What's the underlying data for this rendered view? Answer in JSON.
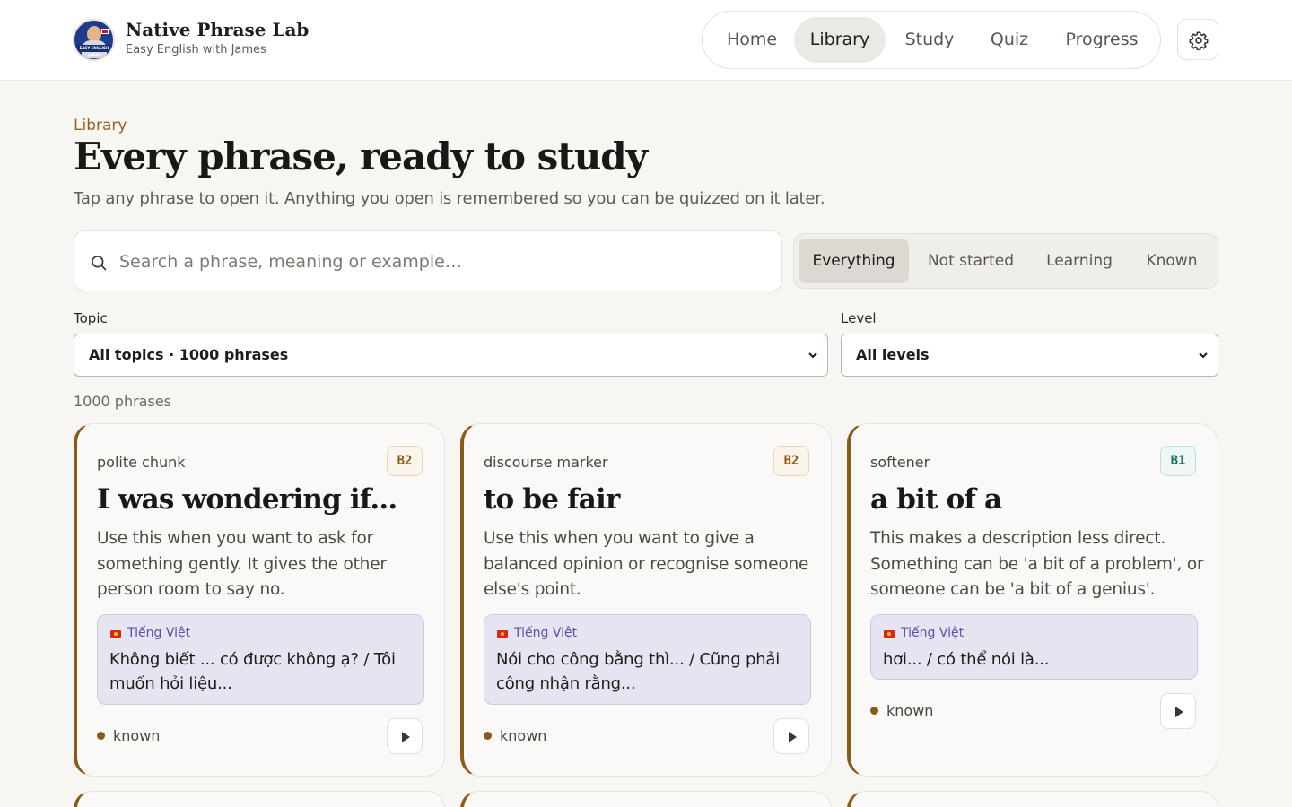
{
  "header": {
    "brand_title": "Native Phrase Lab",
    "brand_subtitle": "Easy English with James",
    "logo_text": "EASY ENGLISH JAMES",
    "nav": [
      {
        "label": "Home",
        "active": false
      },
      {
        "label": "Library",
        "active": true
      },
      {
        "label": "Study",
        "active": false
      },
      {
        "label": "Quiz",
        "active": false
      },
      {
        "label": "Progress",
        "active": false
      }
    ],
    "settings_icon": "gear-icon"
  },
  "page": {
    "eyebrow": "Library",
    "title": "Every phrase, ready to study",
    "lede": "Tap any phrase to open it. Anything you open is remembered so you can be quizzed on it later."
  },
  "search": {
    "placeholder": "Search a phrase, meaning or example…",
    "value": "",
    "icon": "search-icon"
  },
  "status_filter": {
    "options": [
      "Everything",
      "Not started",
      "Learning",
      "Known"
    ],
    "selected": "Everything"
  },
  "filters": {
    "topic_label": "Topic",
    "topic_value": "All topics · 1000 phrases",
    "level_label": "Level",
    "level_value": "All levels"
  },
  "results_count": "1000 phrases",
  "cards": [
    {
      "kind": "polite chunk",
      "level": "B2",
      "phrase": "I was wondering if...",
      "description": "Use this when you want to ask for something gently. It gives the other person room to say no.",
      "vietnamese_label": "Tiếng Việt",
      "vietnamese": "Không biết ... có được không ạ? / Tôi muốn hỏi liệu...",
      "status": "known"
    },
    {
      "kind": "discourse marker",
      "level": "B2",
      "phrase": "to be fair",
      "description": "Use this when you want to give a balanced opinion or recognise someone else's point.",
      "vietnamese_label": "Tiếng Việt",
      "vietnamese": "Nói cho công bằng thì... / Cũng phải công nhận rằng...",
      "status": "known"
    },
    {
      "kind": "softener",
      "level": "B1",
      "phrase": "a bit of a",
      "description": "This makes a description less direct. Something can be 'a bit of a problem', or someone can be 'a bit of a genius'.",
      "vietnamese_label": "Tiếng Việt",
      "vietnamese": "hơi... / có thể nói là...",
      "status": "known"
    }
  ],
  "colors": {
    "accent": "#8a5a17",
    "background": "#f7f6f3",
    "vietnamese_panel": "#e6e4f1",
    "badge_b1": "#1f6f62"
  }
}
